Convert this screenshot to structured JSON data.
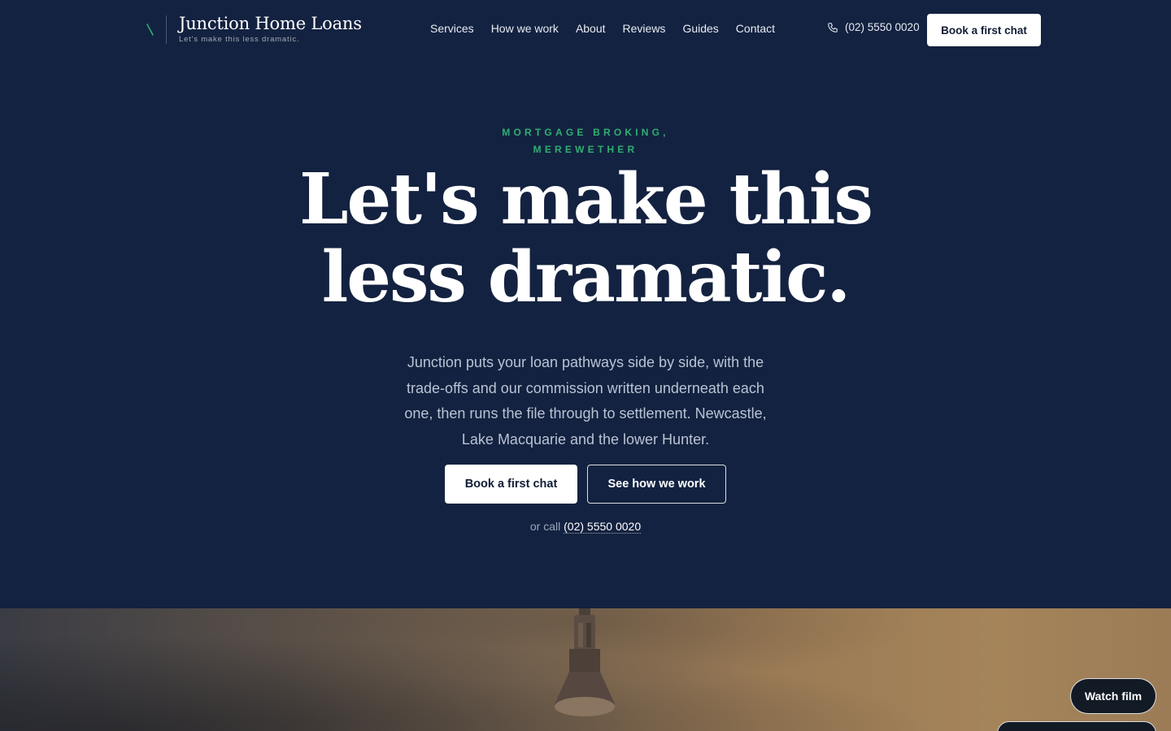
{
  "header": {
    "brand_name": "Junction Home Loans",
    "brand_tagline": "Let's make this less dramatic.",
    "nav": [
      "Services",
      "How we work",
      "About",
      "Reviews",
      "Guides",
      "Contact"
    ],
    "phone": "(02) 5550 0020",
    "phone_icon": "phone-icon",
    "cta_label": "Book a first chat"
  },
  "hero": {
    "eyebrow_line1": "MORTGAGE BROKING,",
    "eyebrow_line2": "MEREWETHER",
    "headline_line1": "Let's make this",
    "headline_line2": "less dramatic.",
    "lede": "Junction puts your loan pathways side by side, with the trade-offs and our commission written underneath each one, then runs the file through to settlement. Newcastle, Lake Macquarie and the lower Hunter.",
    "primary_cta": "Book a first chat",
    "secondary_cta": "See how we work",
    "call_prefix": "or call",
    "call_number": "(02) 5550 0020"
  },
  "media": {
    "watch_film_label": "Watch film"
  },
  "colors": {
    "background": "#132240",
    "accent_green": "#2fae72",
    "button_bg": "#ffffff",
    "button_text": "#0f1d36"
  }
}
